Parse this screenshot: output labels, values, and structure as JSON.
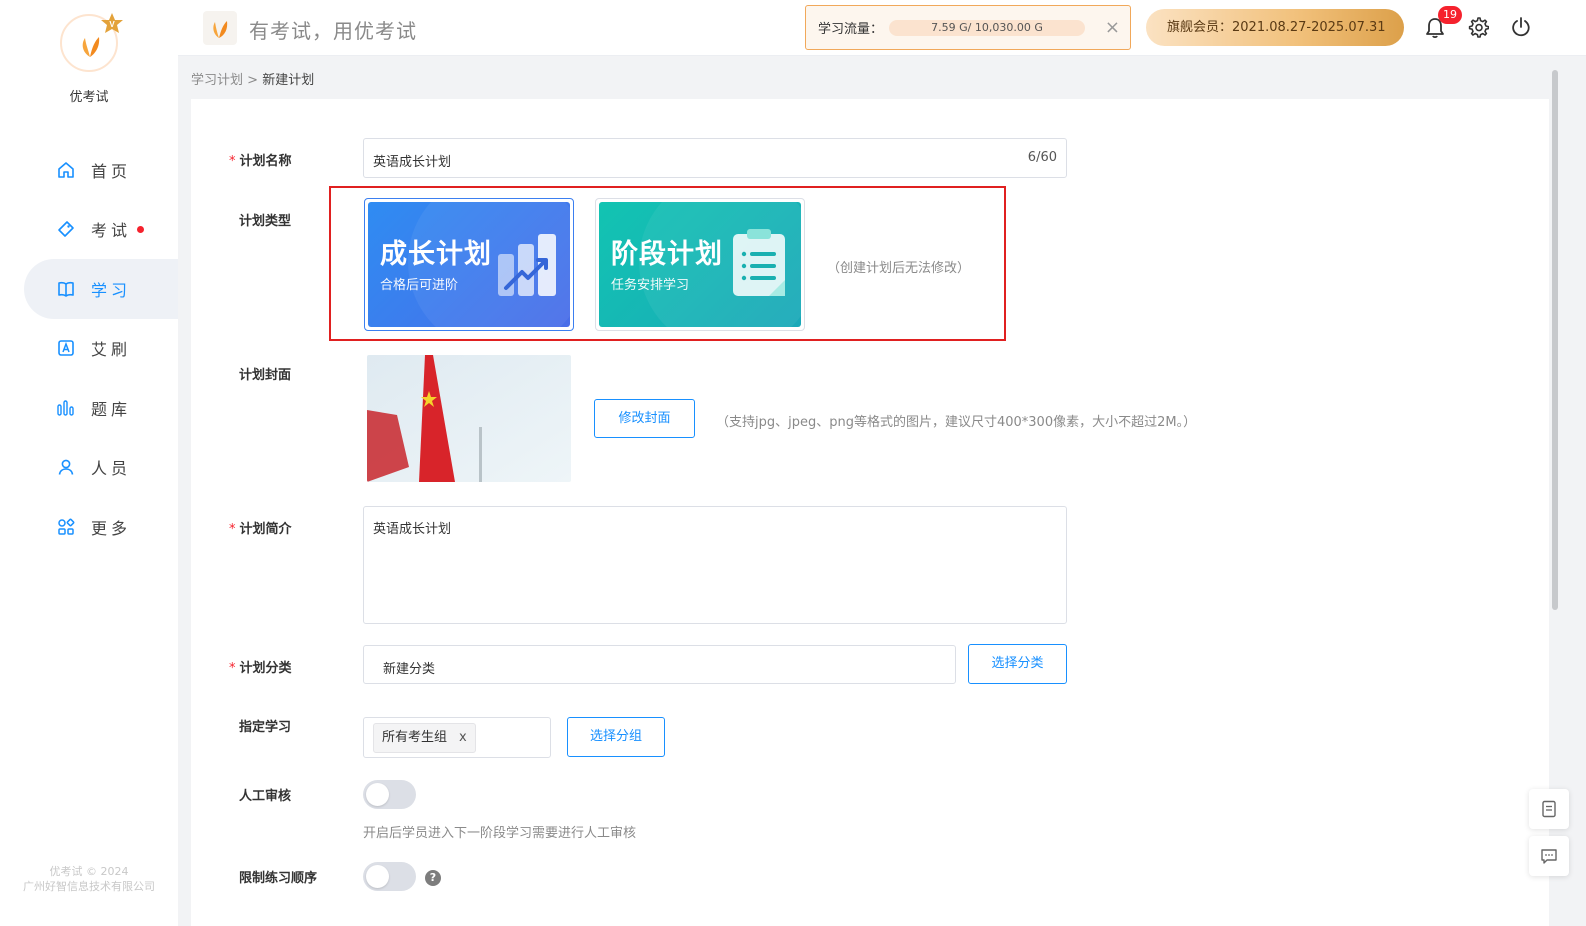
{
  "app": {
    "name": "优考试",
    "slogan": "有考试，用优考试"
  },
  "header": {
    "traffic_label": "学习流量：",
    "traffic_value": "7.59 G/ 10,030.00 G",
    "traffic_progress_fraction": 0.00076,
    "close_glyph": "×",
    "vip_text": "旗舰会员：2021.08.27-2025.07.31",
    "notification_count": "19"
  },
  "sidebar": {
    "items": [
      {
        "label": "首页",
        "icon": "home-icon"
      },
      {
        "label": "考试",
        "icon": "tag-icon",
        "has_dot": true
      },
      {
        "label": "学习",
        "icon": "book-icon",
        "active": true
      },
      {
        "label": "艾刷",
        "icon": "letter-a-icon"
      },
      {
        "label": "题库",
        "icon": "bars-icon"
      },
      {
        "label": "人员",
        "icon": "user-icon"
      },
      {
        "label": "更多",
        "icon": "grid-icon"
      }
    ],
    "copyright_line1": "优考试 © 2024",
    "copyright_line2": "广州好智信息技术有限公司"
  },
  "breadcrumb": {
    "parent": "学习计划",
    "separator": " > ",
    "current": "新建计划"
  },
  "form": {
    "name": {
      "label": "计划名称",
      "value": "英语成长计划",
      "counter": "6/60",
      "required": true
    },
    "type": {
      "label": "计划类型",
      "options": [
        {
          "title": "成长计划",
          "subtitle": "合格后可进阶",
          "selected": true
        },
        {
          "title": "阶段计划",
          "subtitle": "任务安排学习",
          "selected": false
        }
      ],
      "hint": "（创建计划后无法修改）"
    },
    "cover": {
      "label": "计划封面",
      "button": "修改封面",
      "hint": "（支持jpg、jpeg、png等格式的图片，建议尺寸400*300像素，大小不超过2M。）"
    },
    "intro": {
      "label": "计划简介",
      "value": "英语成长计划",
      "required": true
    },
    "category": {
      "label": "计划分类",
      "value": "新建分类",
      "button": "选择分类",
      "required": true
    },
    "assign": {
      "label": "指定学习",
      "tag": "所有考生组",
      "tag_remove": "x",
      "button": "选择分组"
    },
    "review": {
      "label": "人工审核",
      "enabled": false,
      "hint": "开启后学员进入下一阶段学习需要进行人工审核"
    },
    "order": {
      "label": "限制练习顺序",
      "enabled": false,
      "help_glyph": "?"
    }
  },
  "colors": {
    "primary": "#1890ff",
    "danger": "#f5222d",
    "highlight_border": "#e02020",
    "growth_card": "#3b7ff0",
    "stage_card": "#17c2b4",
    "vip_gold": "#dca04a"
  }
}
